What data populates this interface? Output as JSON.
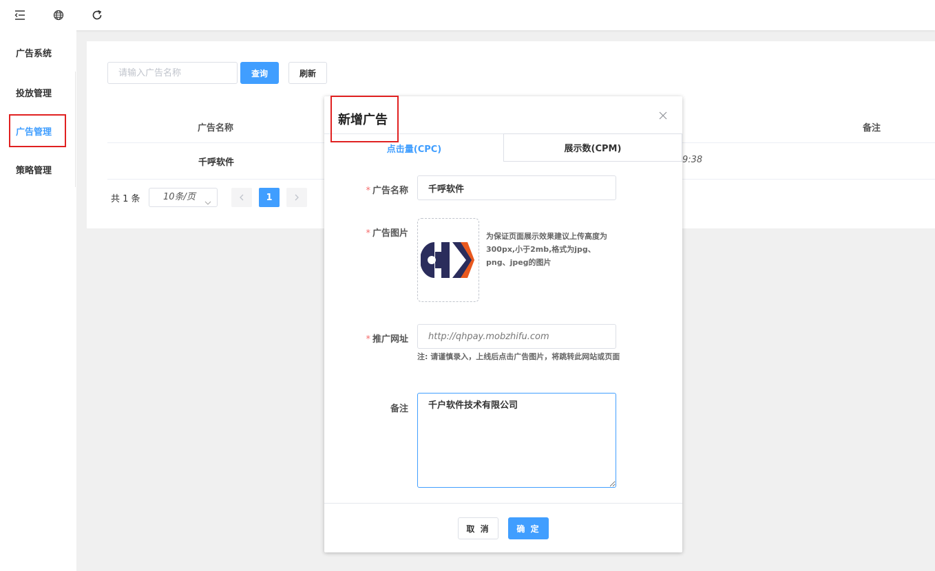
{
  "colors": {
    "accent": "#409eff",
    "highlight": "#e02020",
    "required": "#f56c6c"
  },
  "topbar": {
    "icons": [
      "collapse-menu-icon",
      "globe-icon",
      "refresh-icon"
    ]
  },
  "sidebar": {
    "items": [
      {
        "label": "广告系统"
      },
      {
        "label": "投放管理"
      },
      {
        "label": "广告管理",
        "active": true
      },
      {
        "label": "策略管理"
      }
    ]
  },
  "search": {
    "placeholder": "请输入广告名称",
    "query_label": "查询",
    "refresh_label": "刷新"
  },
  "table": {
    "columns": [
      "广告名称",
      "备注"
    ],
    "rows": [
      {
        "name": "千呼软件",
        "time_fragment": "9:38"
      }
    ]
  },
  "pagination": {
    "total_text": "共 1 条",
    "page_size": "10条/页",
    "current_page": "1"
  },
  "dialog": {
    "title": "新增广告",
    "tabs": [
      {
        "label": "点击量(CPC)",
        "active": true
      },
      {
        "label": "展示数(CPM)"
      }
    ],
    "fields": {
      "name": {
        "label": "广告名称",
        "value": "千呼软件",
        "required": true
      },
      "image": {
        "label": "广告图片",
        "required": true,
        "tip": "为保证页面展示效果建议上传高度为300px,小于2mb,格式为jpg、png、jpeg的图片"
      },
      "url": {
        "label": "推广网址",
        "placeholder": "http://qhpay.mobzhifu.com",
        "required": true,
        "note": "注: 请谨慎录入，上线后点击广告图片，将跳转此网站或页面"
      },
      "remark": {
        "label": "备注",
        "value": "千户软件技术有限公司"
      }
    },
    "cancel_label": "取 消",
    "confirm_label": "确 定"
  }
}
